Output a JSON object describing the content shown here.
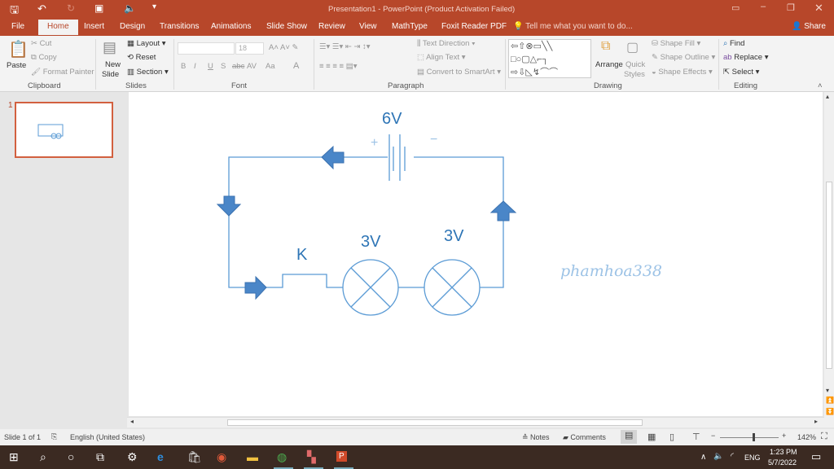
{
  "title": "Presentation1 - PowerPoint (Product Activation Failed)",
  "tabs": [
    "File",
    "Home",
    "Insert",
    "Design",
    "Transitions",
    "Animations",
    "Slide Show",
    "Review",
    "View",
    "MathType",
    "Foxit Reader PDF"
  ],
  "tell_me": "Tell me what you want to do...",
  "share": "Share",
  "clipboard": {
    "paste": "Paste",
    "cut": "Cut",
    "copy": "Copy",
    "format_painter": "Format Painter",
    "label": "Clipboard"
  },
  "slides": {
    "new_slide": "New",
    "new_slide2": "Slide",
    "layout": "Layout",
    "reset": "Reset",
    "section": "Section",
    "label": "Slides"
  },
  "font": {
    "size": "18",
    "label": "Font",
    "buttons": [
      "B",
      "I",
      "U",
      "S",
      "abc",
      "AV",
      "Aa",
      "A"
    ]
  },
  "paragraph": {
    "text_direction": "Text Direction",
    "align_text": "Align Text",
    "smartart": "Convert to SmartArt",
    "label": "Paragraph"
  },
  "drawing": {
    "arrange": "Arrange",
    "quick_styles": "Quick",
    "quick_styles2": "Styles",
    "shape_fill": "Shape Fill",
    "shape_outline": "Shape Outline",
    "shape_effects": "Shape Effects",
    "label": "Drawing"
  },
  "editing": {
    "find": "Find",
    "replace": "Replace",
    "select": "Select",
    "label": "Editing"
  },
  "thumbnail_number": "1",
  "slide": {
    "battery": "6V",
    "plus": "+",
    "minus": "−",
    "switch": "K",
    "lamp1": "3V",
    "lamp2": "3V",
    "watermark": "phamhoa338"
  },
  "status": {
    "slide": "Slide 1 of 1",
    "language": "English (United States)",
    "notes": "Notes",
    "comments": "Comments",
    "zoom": "142%"
  },
  "taskbar": {
    "lang": "ENG",
    "time": "1:23 PM",
    "date": "5/7/2022"
  },
  "colors": {
    "accent": "#b7472a",
    "circuit": "#5b9bd5",
    "arrow": "#4a86c8"
  }
}
